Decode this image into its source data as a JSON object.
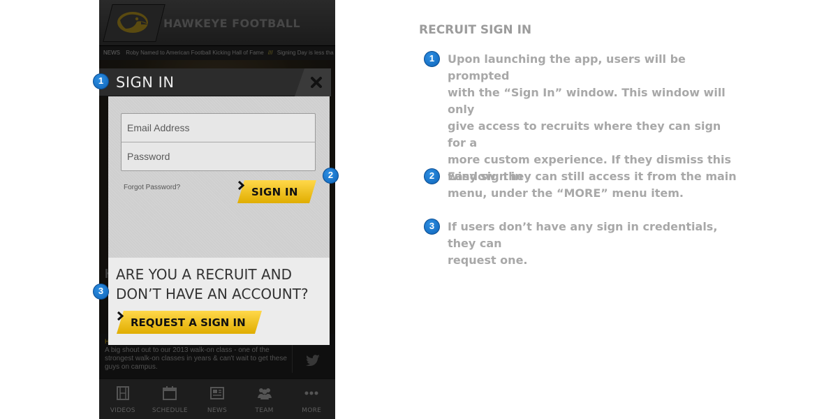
{
  "app": {
    "title": "HAWKEYE FOOTBALL"
  },
  "ticker": {
    "label": "NEWS",
    "item1": "Roby Named to American Football Kicking Hall of Fame",
    "separator": "///",
    "item2": "Signing Day is less tha"
  },
  "background": {
    "letter1": "H",
    "letter2": "L",
    "tweet_accent": "H",
    "tweet_text": "A big shout out to our 2013 walk-on class - one of the strongest walk-on classes in years & can't wait to get these guys on campus."
  },
  "tabs": [
    {
      "label": "VIDEOS",
      "icon": "film-icon"
    },
    {
      "label": "SCHEDULE",
      "icon": "calendar-icon"
    },
    {
      "label": "NEWS",
      "icon": "newspaper-icon"
    },
    {
      "label": "TEAM",
      "icon": "team-icon"
    },
    {
      "label": "MORE",
      "icon": "more-dots-icon"
    }
  ],
  "modal": {
    "title": "SIGN IN",
    "email_placeholder": "Email Address",
    "password_placeholder": "Password",
    "forgot": "Forgot Password?",
    "sign_in_label": "SIGN IN",
    "recruit_line1": "ARE YOU A RECRUIT AND",
    "recruit_line2": "DON’T HAVE AN ACCOUNT?",
    "request_label": "REQUEST A SIGN IN"
  },
  "markers": [
    "1",
    "2",
    "3"
  ],
  "annotations": {
    "title": "RECRUIT SIGN IN",
    "items": [
      {
        "number": "1",
        "lines": [
          "Upon launching the app, users will be prompted",
          "with the “Sign In” window. This window will only",
          "give access to recruits where they can sign for a",
          "more custom experience. If they dismiss this",
          "window, they can still access it from the main",
          "menu, under the “MORE” menu item."
        ]
      },
      {
        "number": "2",
        "lines": [
          "Easy sign in"
        ]
      },
      {
        "number": "3",
        "lines": [
          "If users don’t have any sign in credentials, they can",
          "request one."
        ]
      }
    ]
  },
  "colors": {
    "accent_yellow": "#f3c400",
    "marker_blue": "#1777cf",
    "annotation_gray": "#a8a8a8"
  }
}
